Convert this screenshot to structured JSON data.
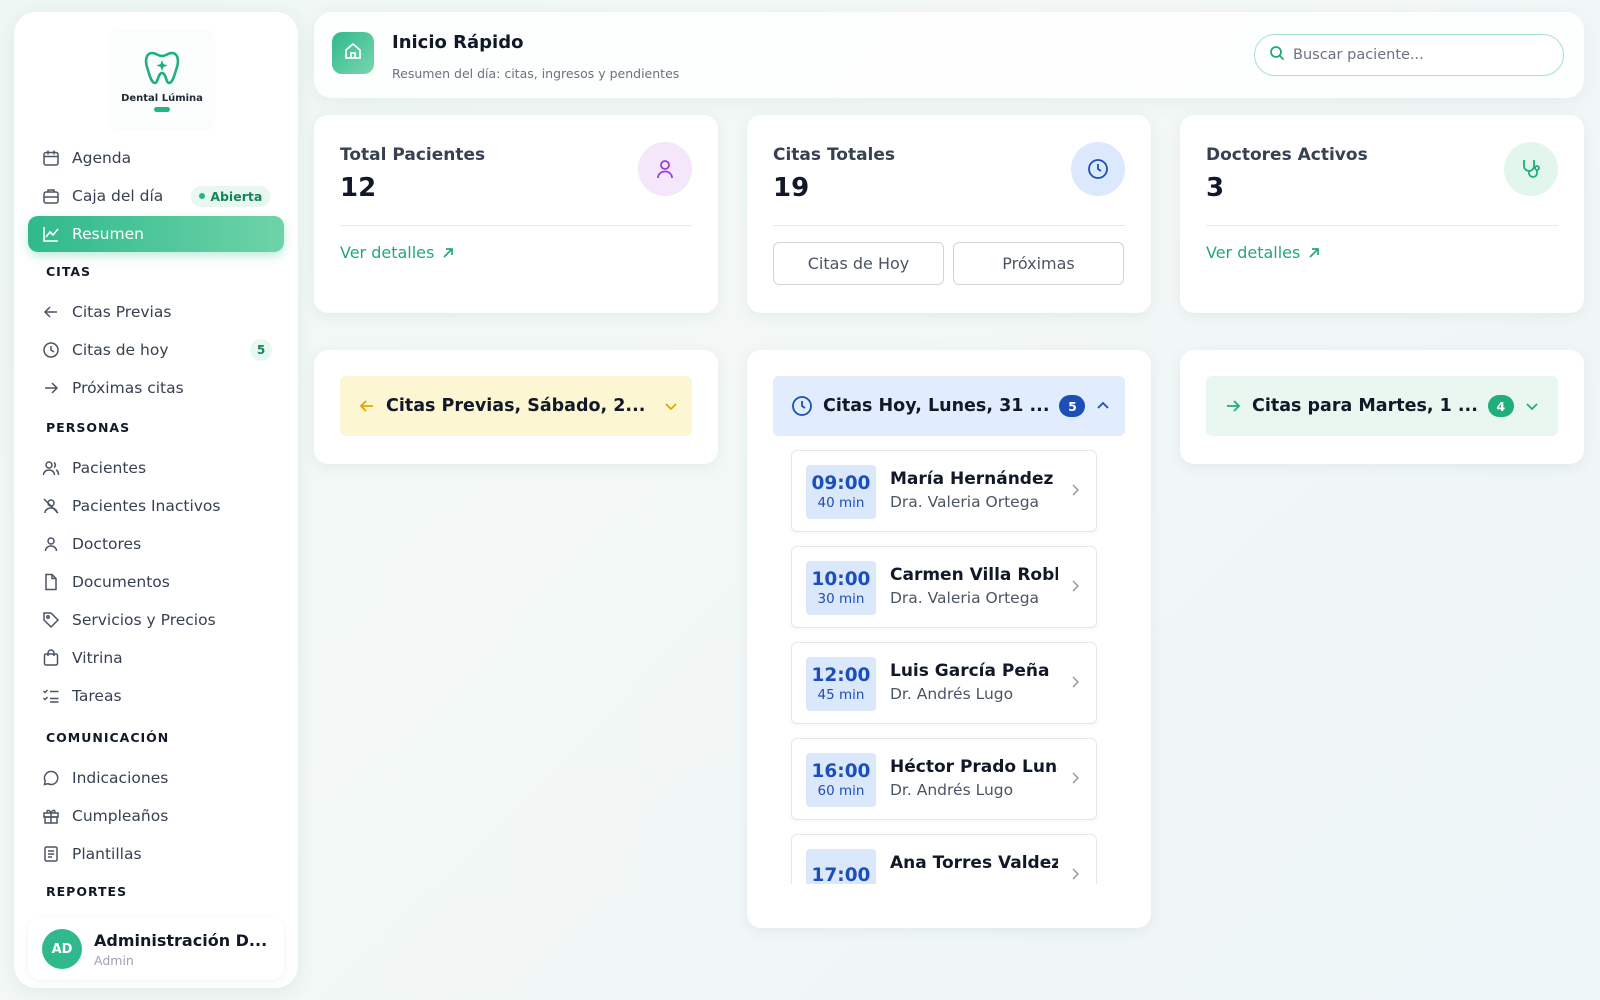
{
  "sidebar": {
    "logo_name": "Dental Lúmina",
    "items": [
      {
        "label": "Agenda"
      },
      {
        "label": "Caja del día",
        "badge": "Abierta"
      },
      {
        "label": "Resumen"
      }
    ],
    "sections": {
      "citas": {
        "title": "CITAS",
        "items": [
          {
            "label": "Citas Previas"
          },
          {
            "label": "Citas de hoy",
            "count": "5"
          },
          {
            "label": "Próximas citas"
          }
        ]
      },
      "personas": {
        "title": "PERSONAS",
        "items": [
          {
            "label": "Pacientes"
          },
          {
            "label": "Pacientes Inactivos"
          },
          {
            "label": "Doctores"
          },
          {
            "label": "Documentos"
          },
          {
            "label": "Servicios y Precios"
          },
          {
            "label": "Vitrina"
          },
          {
            "label": "Tareas"
          }
        ]
      },
      "comunicacion": {
        "title": "COMUNICACIÓN",
        "items": [
          {
            "label": "Indicaciones"
          },
          {
            "label": "Cumpleaños"
          },
          {
            "label": "Plantillas"
          }
        ]
      },
      "reportes": {
        "title": "REPORTES"
      }
    },
    "user": {
      "initials": "AD",
      "name": "Administración D...",
      "role": "Admin"
    }
  },
  "header": {
    "title": "Inicio Rápido",
    "subtitle": "Resumen del día: citas, ingresos y pendientes",
    "search_placeholder": "Buscar paciente..."
  },
  "stats": {
    "patients": {
      "title": "Total Pacientes",
      "value": "12",
      "link": "Ver detalles"
    },
    "appointments": {
      "title": "Citas Totales",
      "value": "19",
      "btn_today": "Citas de Hoy",
      "btn_next": "Próximas"
    },
    "doctors": {
      "title": "Doctores Activos",
      "value": "3",
      "link": "Ver detalles"
    }
  },
  "panels": {
    "previous": {
      "title": "Citas Previas, Sábado, 2...",
      "color": "#f5c518"
    },
    "today": {
      "title": "Citas Hoy, Lunes, 31 ...",
      "count": "5",
      "appointments": [
        {
          "time": "09:00",
          "duration": "40 min",
          "patient": "María Hernández",
          "doctor": "Dra. Valeria Ortega"
        },
        {
          "time": "10:00",
          "duration": "30 min",
          "patient": "Carmen Villa Robles",
          "doctor": "Dra. Valeria Ortega"
        },
        {
          "time": "12:00",
          "duration": "45 min",
          "patient": "Luis García Peña",
          "doctor": "Dr. Andrés Lugo"
        },
        {
          "time": "16:00",
          "duration": "60 min",
          "patient": "Héctor Prado Luna",
          "doctor": "Dr. Andrés Lugo"
        },
        {
          "time": "17:00",
          "duration": "",
          "patient": "Ana Torres Valdez",
          "doctor": ""
        }
      ]
    },
    "next": {
      "title": "Citas para Martes, 1 ...",
      "count": "4"
    }
  },
  "colors": {
    "accent": "#2fb98c",
    "blue": "#1d4fb8",
    "purple": "#9b40d6"
  }
}
